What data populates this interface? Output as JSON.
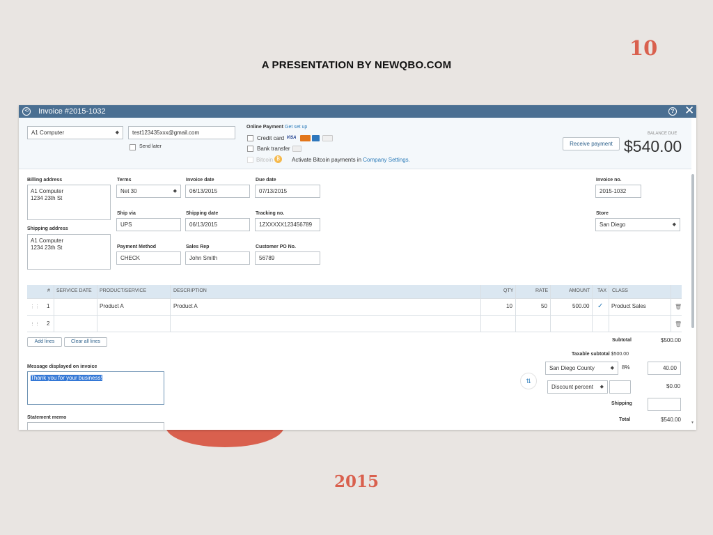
{
  "slide": {
    "number": "10",
    "title": "A PRESENTATION BY NEWQBO.COM",
    "year": "2015"
  },
  "window": {
    "title": "Invoice #2015-1032",
    "icons": [
      "history-icon",
      "help-icon",
      "close-icon"
    ]
  },
  "customer": {
    "name": "A1 Computer",
    "email": "test123435xxx@gmail.com",
    "send_later": "Send later"
  },
  "online_payment": {
    "label": "Online Payment",
    "setup_link": "Get set up",
    "credit_card": "Credit card",
    "bank_transfer": "Bank transfer",
    "bitcoin": "Bitcoin",
    "bitcoin_note_prefix": "Activate Bitcoin payments in",
    "bitcoin_note_link": "Company Settings."
  },
  "balance": {
    "receive_payment": "Receive payment",
    "label": "BALANCE DUE",
    "amount": "$540.00"
  },
  "billing": {
    "label": "Billing address",
    "line1": "A1 Computer",
    "line2": "1234 23th St"
  },
  "shipping_addr": {
    "label": "Shipping address",
    "line1": "A1 Computer",
    "line2": "1234 23th St"
  },
  "fields": {
    "terms_label": "Terms",
    "terms": "Net 30",
    "invoice_date_label": "Invoice date",
    "invoice_date": "06/13/2015",
    "due_date_label": "Due date",
    "due_date": "07/13/2015",
    "ship_via_label": "Ship via",
    "ship_via": "UPS",
    "shipping_date_label": "Shipping date",
    "shipping_date": "06/13/2015",
    "tracking_label": "Tracking no.",
    "tracking": "1ZXXXXX123456789",
    "payment_method_label": "Payment Method",
    "payment_method": "CHECK",
    "sales_rep_label": "Sales Rep",
    "sales_rep": "John Smith",
    "po_label": "Customer PO No.",
    "po": "56789",
    "invoice_no_label": "Invoice no.",
    "invoice_no": "2015-1032",
    "store_label": "Store",
    "store": "San Diego"
  },
  "table": {
    "headers": [
      "#",
      "SERVICE DATE",
      "PRODUCT/SERVICE",
      "DESCRIPTION",
      "QTY",
      "RATE",
      "AMOUNT",
      "TAX",
      "CLASS"
    ],
    "rows": [
      {
        "num": "1",
        "service_date": "",
        "product": "Product A",
        "description": "Product A",
        "qty": "10",
        "rate": "50",
        "amount": "500.00",
        "tax": "✓",
        "class": "Product Sales"
      },
      {
        "num": "2",
        "service_date": "",
        "product": "",
        "description": "",
        "qty": "",
        "rate": "",
        "amount": "",
        "tax": "",
        "class": ""
      }
    ],
    "add_lines": "Add lines",
    "clear_lines": "Clear all lines"
  },
  "totals": {
    "subtotal_label": "Subtotal",
    "subtotal": "$500.00",
    "taxable_label": "Taxable subtotal",
    "taxable": "$500.00",
    "tax_region": "San Diego County",
    "tax_rate": "8%",
    "tax_amount": "40.00",
    "discount_type": "Discount percent",
    "discount_value": "",
    "discount_amount": "$0.00",
    "shipping_label": "Shipping",
    "shipping_value": "",
    "total_label": "Total",
    "total": "$540.00"
  },
  "message": {
    "label": "Message displayed on invoice",
    "text": "Thank you for your business!"
  },
  "memo": {
    "label": "Statement memo"
  },
  "colors": {
    "accent": "#d9604e",
    "titlebar": "#4a6f92",
    "link": "#2b7bb9",
    "grid_header": "#dbe7f1"
  }
}
